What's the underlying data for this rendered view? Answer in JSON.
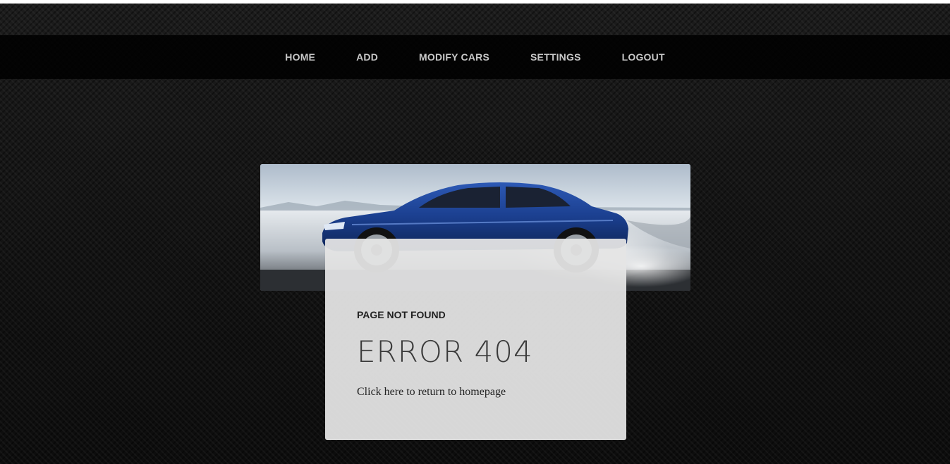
{
  "nav": {
    "items": [
      {
        "label": "HOME"
      },
      {
        "label": "ADD"
      },
      {
        "label": "MODIFY CARS"
      },
      {
        "label": "SETTINGS"
      },
      {
        "label": "LOGOUT"
      }
    ]
  },
  "hero": {
    "image": "blue-sedan-drifting-photo"
  },
  "error_card": {
    "subtitle": "PAGE NOT FOUND",
    "title": "ERROR 404",
    "link_text": "Click here to return to homepage"
  },
  "colors": {
    "background": "#141414",
    "navbar": "#000000",
    "nav_text": "#c8c8c8",
    "card": "#e4e4e4",
    "car_body": "#1b3f8f"
  }
}
